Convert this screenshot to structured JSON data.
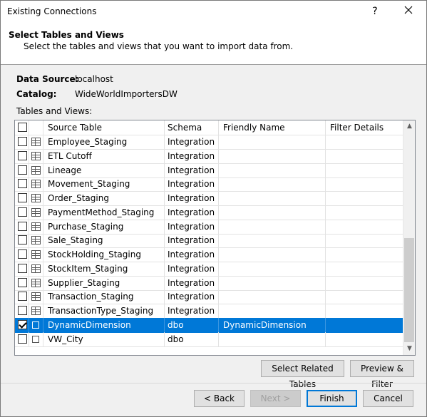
{
  "window": {
    "title": "Existing Connections",
    "help_glyph": "?",
    "close_glyph": "✕"
  },
  "header": {
    "title": "Select Tables and Views",
    "subtitle": "Select the tables and views that you want to import data from."
  },
  "info": {
    "data_source_label": "Data Source:",
    "data_source_value": "localhost",
    "catalog_label": "Catalog:",
    "catalog_value": "WideWorldImportersDW",
    "tables_label": "Tables and Views:"
  },
  "grid": {
    "columns": {
      "source": "Source Table",
      "schema": "Schema",
      "friendly": "Friendly Name",
      "filter": "Filter Details"
    },
    "rows": [
      {
        "source": "Employee_Staging",
        "schema": "Integration",
        "friendly": "",
        "filter": "",
        "checked": false,
        "kind": "table"
      },
      {
        "source": "ETL Cutoff",
        "schema": "Integration",
        "friendly": "",
        "filter": "",
        "checked": false,
        "kind": "table"
      },
      {
        "source": "Lineage",
        "schema": "Integration",
        "friendly": "",
        "filter": "",
        "checked": false,
        "kind": "table"
      },
      {
        "source": "Movement_Staging",
        "schema": "Integration",
        "friendly": "",
        "filter": "",
        "checked": false,
        "kind": "table"
      },
      {
        "source": "Order_Staging",
        "schema": "Integration",
        "friendly": "",
        "filter": "",
        "checked": false,
        "kind": "table"
      },
      {
        "source": "PaymentMethod_Staging",
        "schema": "Integration",
        "friendly": "",
        "filter": "",
        "checked": false,
        "kind": "table"
      },
      {
        "source": "Purchase_Staging",
        "schema": "Integration",
        "friendly": "",
        "filter": "",
        "checked": false,
        "kind": "table"
      },
      {
        "source": "Sale_Staging",
        "schema": "Integration",
        "friendly": "",
        "filter": "",
        "checked": false,
        "kind": "table"
      },
      {
        "source": "StockHolding_Staging",
        "schema": "Integration",
        "friendly": "",
        "filter": "",
        "checked": false,
        "kind": "table"
      },
      {
        "source": "StockItem_Staging",
        "schema": "Integration",
        "friendly": "",
        "filter": "",
        "checked": false,
        "kind": "table"
      },
      {
        "source": "Supplier_Staging",
        "schema": "Integration",
        "friendly": "",
        "filter": "",
        "checked": false,
        "kind": "table"
      },
      {
        "source": "Transaction_Staging",
        "schema": "Integration",
        "friendly": "",
        "filter": "",
        "checked": false,
        "kind": "table"
      },
      {
        "source": "TransactionType_Staging",
        "schema": "Integration",
        "friendly": "",
        "filter": "",
        "checked": false,
        "kind": "table"
      },
      {
        "source": "DynamicDimension",
        "schema": "dbo",
        "friendly": "DynamicDimension",
        "filter": "",
        "checked": true,
        "kind": "view",
        "selected": true
      },
      {
        "source": "VW_City",
        "schema": "dbo",
        "friendly": "",
        "filter": "",
        "checked": false,
        "kind": "view"
      }
    ],
    "scroll_up_glyph": "▲",
    "scroll_down_glyph": "▼"
  },
  "buttons": {
    "select_related": "Select Related Tables",
    "preview_filter": "Preview & Filter",
    "back": "< Back",
    "next": "Next >",
    "finish": "Finish",
    "cancel": "Cancel"
  }
}
